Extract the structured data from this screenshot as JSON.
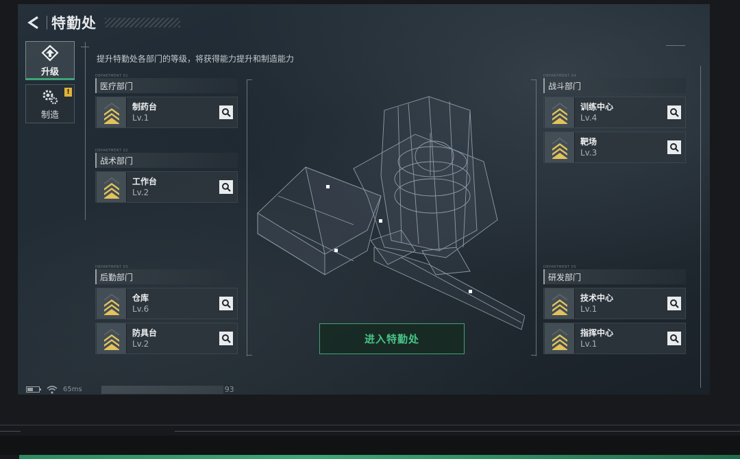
{
  "header": {
    "title": "特勤处"
  },
  "sidebar": [
    {
      "label": "升级",
      "icon": "upgrade-icon",
      "active": true
    },
    {
      "label": "制造",
      "icon": "gear-icon",
      "badge": "!"
    }
  ],
  "subtitle": "提升特勤处各部门的等级，将获得能力提升和制造能力",
  "departments": {
    "medical": {
      "tag": "DEPARTMENT 01",
      "title": "医疗部门",
      "items": [
        {
          "name": "制药台",
          "level": "Lv.1"
        }
      ]
    },
    "tactical": {
      "tag": "DEPARTMENT 02",
      "title": "战术部门",
      "items": [
        {
          "name": "工作台",
          "level": "Lv.2"
        }
      ]
    },
    "logistics": {
      "tag": "DEPARTMENT 03",
      "title": "后勤部门",
      "items": [
        {
          "name": "仓库",
          "level": "Lv.6"
        },
        {
          "name": "防具台",
          "level": "Lv.2"
        }
      ]
    },
    "combat": {
      "tag": "DEPARTMENT 04",
      "title": "战斗部门",
      "items": [
        {
          "name": "训练中心",
          "level": "Lv.4"
        },
        {
          "name": "靶场",
          "level": "Lv.3"
        }
      ]
    },
    "research": {
      "tag": "DEPARTMENT 05",
      "title": "研发部门",
      "items": [
        {
          "name": "技术中心",
          "level": "Lv.1"
        },
        {
          "name": "指挥中心",
          "level": "Lv.1"
        }
      ]
    }
  },
  "enter_button": "进入特勤处",
  "status": {
    "ping": "65ms",
    "uid_tail": "93"
  },
  "colors": {
    "accent_green": "#3ea677",
    "rank_gold": "#e2c25a",
    "badge_yellow": "#e0b43a"
  }
}
